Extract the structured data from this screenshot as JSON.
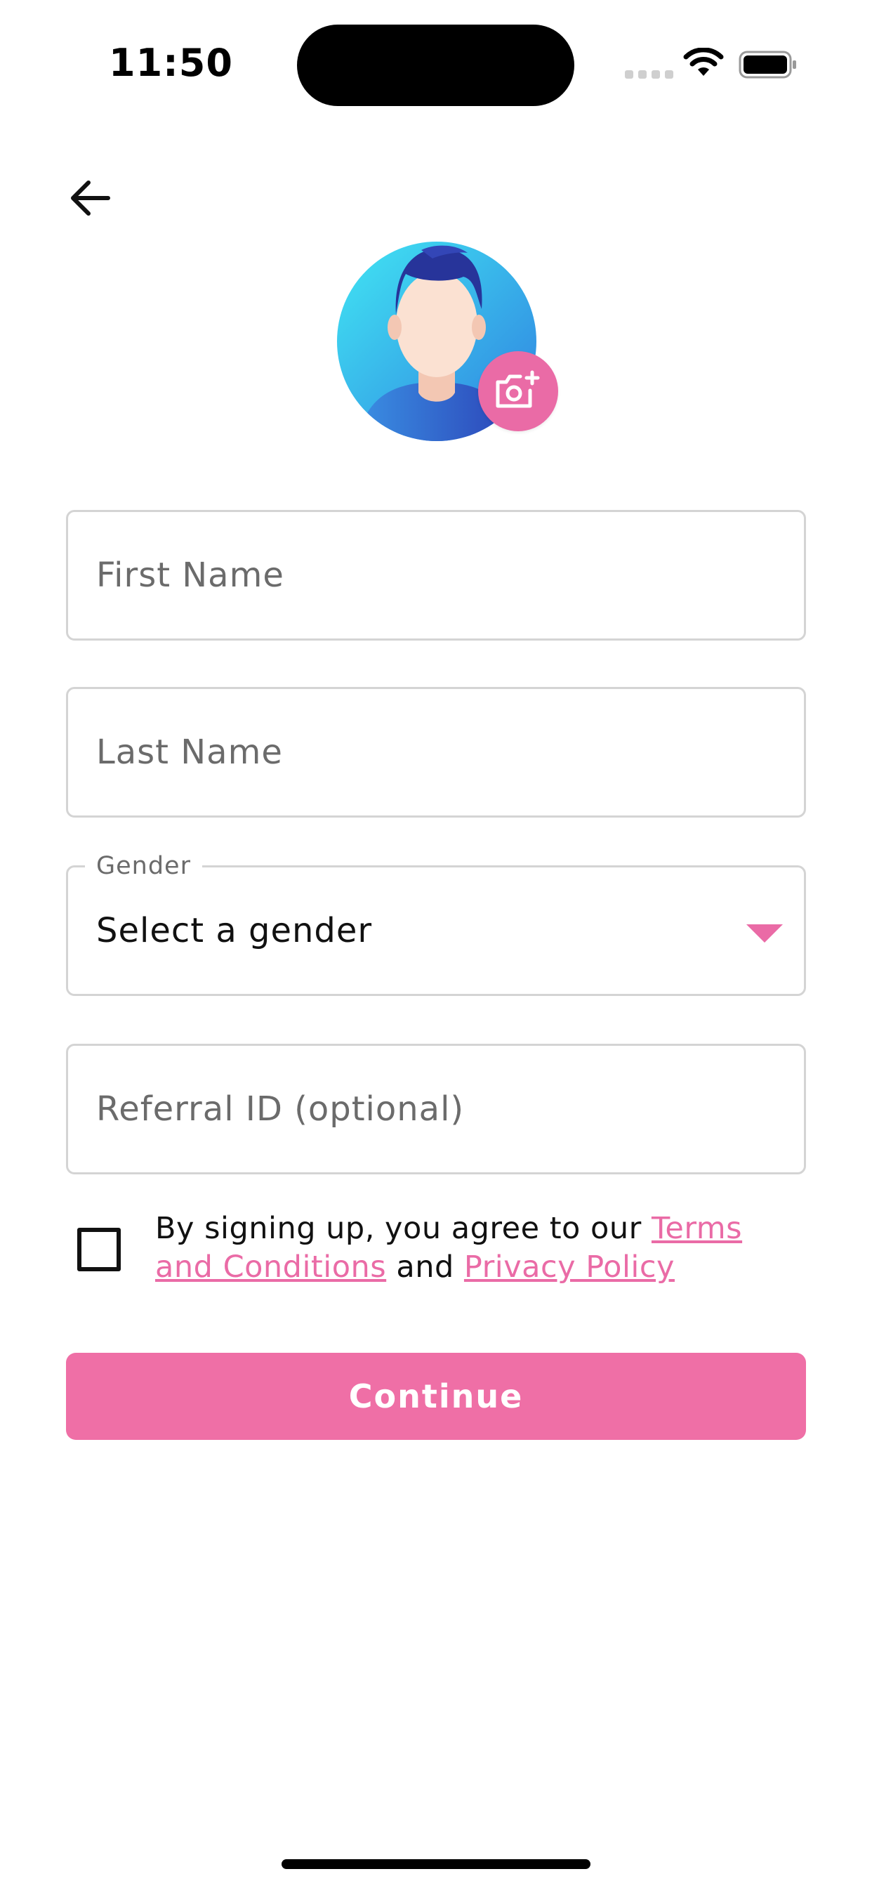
{
  "status_bar": {
    "time": "11:50"
  },
  "form": {
    "first_name": {
      "placeholder": "First Name",
      "value": ""
    },
    "last_name": {
      "placeholder": "Last Name",
      "value": ""
    },
    "gender": {
      "label": "Gender",
      "selected": "Select a gender"
    },
    "referral": {
      "placeholder": "Referral ID (optional)",
      "value": ""
    }
  },
  "agreement": {
    "checked": false,
    "prefix": "By signing up, you agree to our ",
    "terms_link": "Terms and Conditions",
    "and_text": " and ",
    "privacy_link": "Privacy Policy"
  },
  "continue_label": "Continue",
  "icons": {
    "back": "arrow-left-icon",
    "camera": "camera-add-icon",
    "dropdown": "caret-down-icon",
    "wifi": "wifi-icon",
    "battery": "battery-icon"
  },
  "colors": {
    "accent": "#ea6ba6",
    "button": "#ef6fa6",
    "border": "#d4d4d4",
    "placeholder": "#6b6b6b"
  }
}
